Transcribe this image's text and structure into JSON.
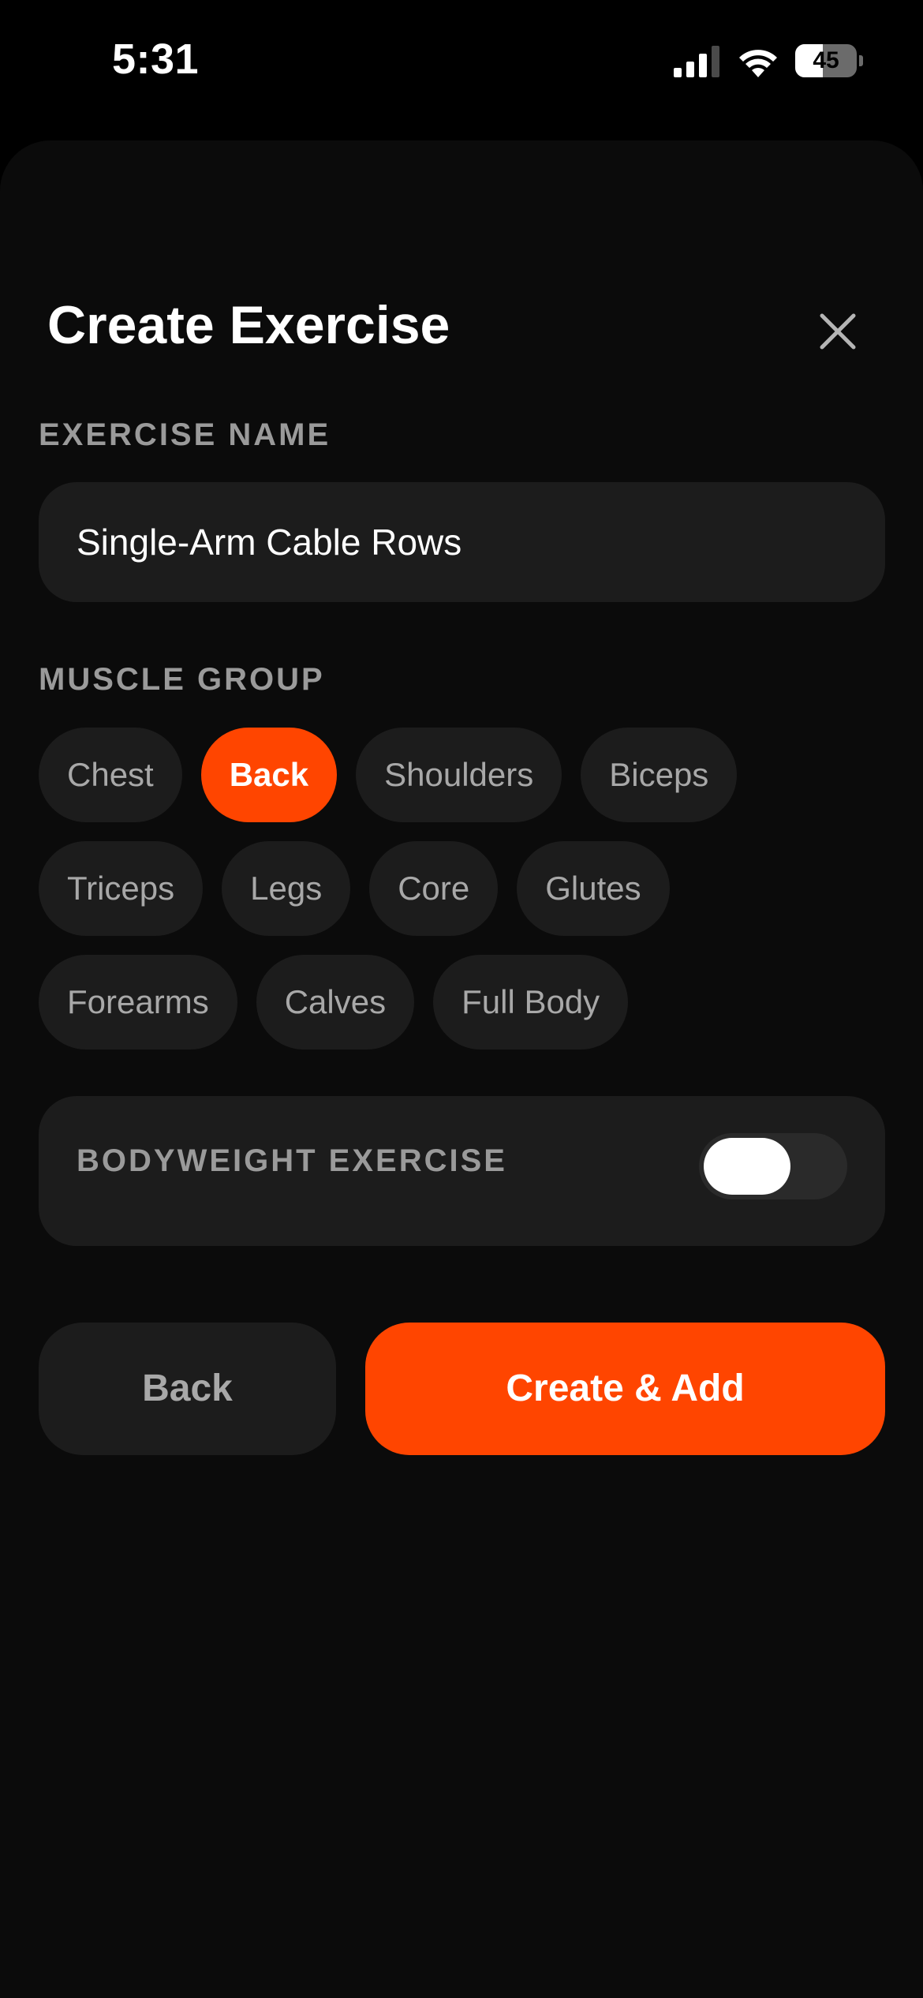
{
  "status_bar": {
    "time": "5:31",
    "battery_percent": "45",
    "battery_level": 0.45,
    "icons": [
      "signal-icon",
      "wifi-icon",
      "battery-icon"
    ]
  },
  "sheet": {
    "title": "Create Exercise",
    "close_icon": "close-icon"
  },
  "exercise_name": {
    "label": "EXERCISE NAME",
    "value": "Single-Arm Cable Rows"
  },
  "muscle_group": {
    "label": "MUSCLE GROUP",
    "selected": "Back",
    "rows": [
      [
        "Chest",
        "Back",
        "Shoulders",
        "Biceps"
      ],
      [
        "Triceps",
        "Legs",
        "Core",
        "Glutes"
      ],
      [
        "Forearms",
        "Calves",
        "Full Body"
      ]
    ]
  },
  "bodyweight": {
    "label": "BODYWEIGHT EXERCISE",
    "enabled": false
  },
  "actions": {
    "back_label": "Back",
    "create_label": "Create & Add"
  },
  "colors": {
    "accent": "#ff4500",
    "background": "#000000",
    "surface": "#1c1c1c",
    "muted_text": "#9a9a9a"
  }
}
